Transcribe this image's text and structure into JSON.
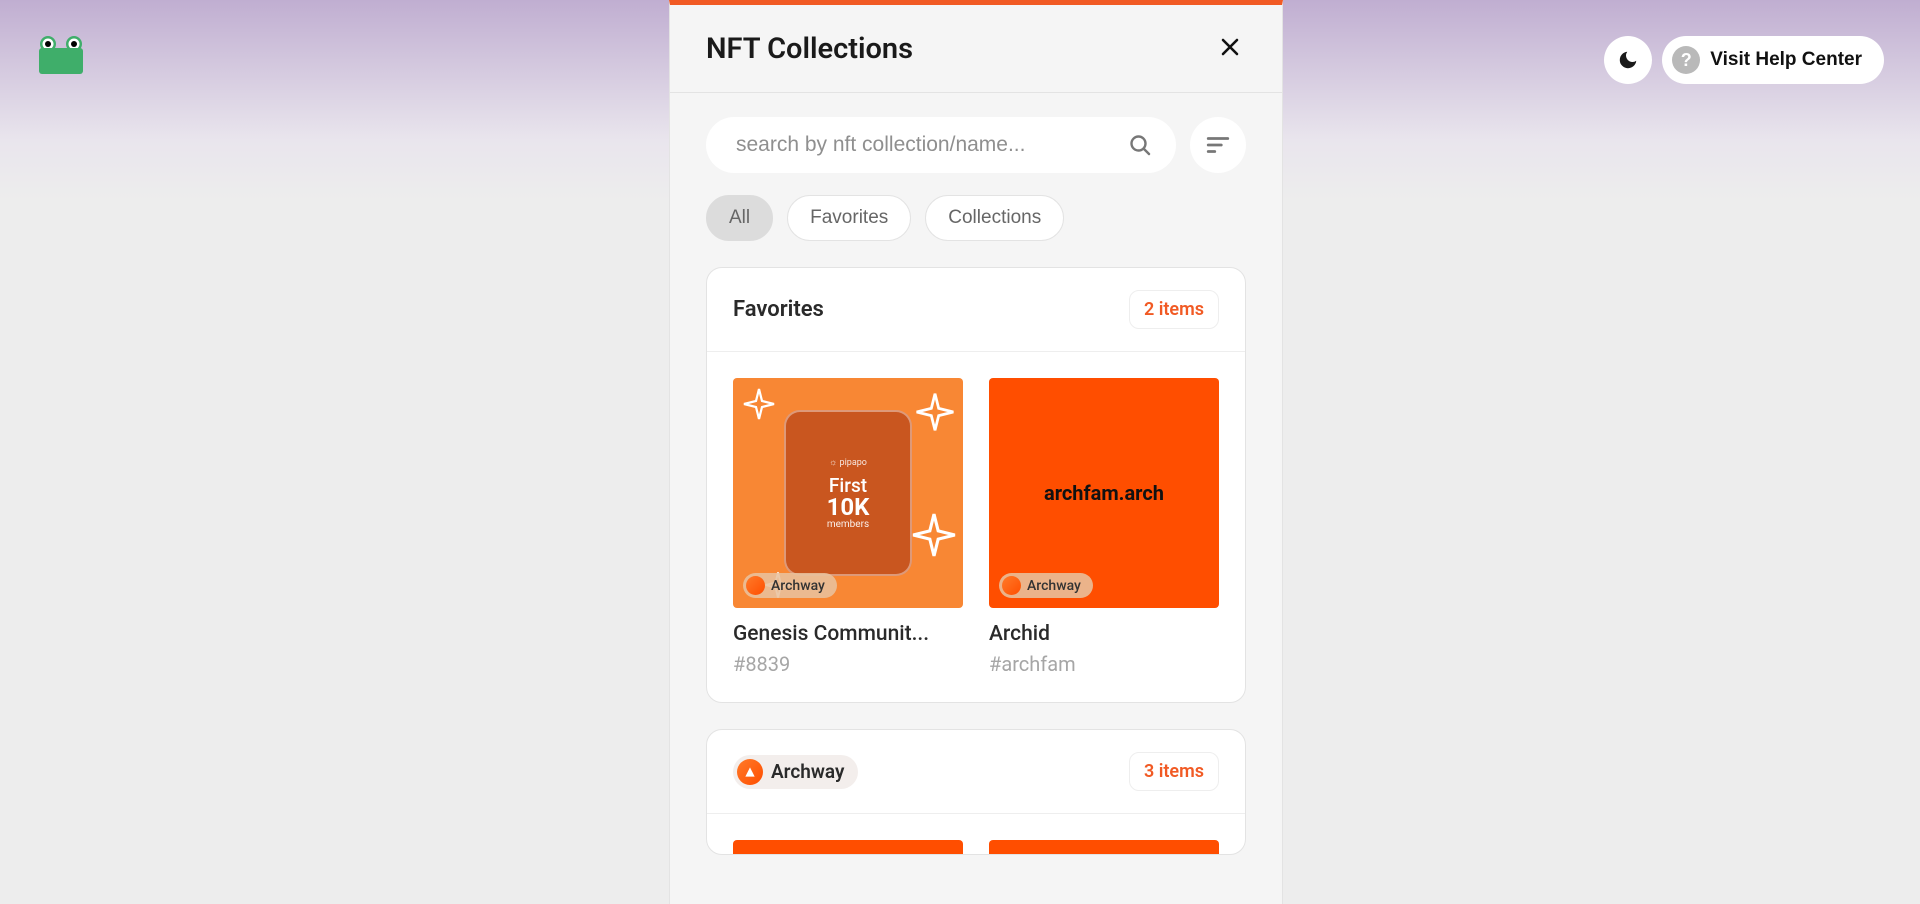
{
  "header": {
    "help_label": "Visit Help Center"
  },
  "panel": {
    "title": "NFT Collections",
    "search_placeholder": "search by nft collection/name...",
    "chips": [
      "All",
      "Favorites",
      "Collections"
    ],
    "active_chip": "All"
  },
  "favorites": {
    "title": "Favorites",
    "count_label": "2 items",
    "items": [
      {
        "title": "Genesis Communit...",
        "sub": "#8839",
        "chain": "Archway",
        "thumb_small": "☼ pipapo",
        "thumb_line1": "First",
        "thumb_line2": "10K",
        "thumb_line3": "members"
      },
      {
        "title": "Archid",
        "sub": "#archfam",
        "chain": "Archway",
        "thumb_text": "archfam.arch"
      }
    ]
  },
  "archway": {
    "chain": "Archway",
    "count_label": "3 items"
  }
}
